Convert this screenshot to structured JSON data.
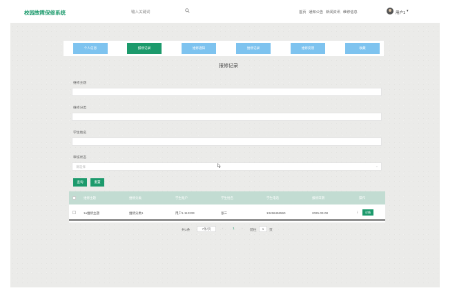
{
  "header": {
    "brand": "校园故障保修系统",
    "search_placeholder": "输入关键词",
    "nav": [
      "首页",
      "通知公告",
      "新闻资讯",
      "维修信息"
    ],
    "username": "用户1"
  },
  "tabs": [
    "个人信息",
    "报修记录",
    "维修通知",
    "维修记录",
    "维修反馈",
    "收藏"
  ],
  "active_tab_index": 1,
  "page_title": "报修记录",
  "filters": {
    "topic_label": "维修主题",
    "category_label": "维修分类",
    "student_label": "学生姓名",
    "status_label": "审核状态",
    "status_placeholder": "请选择"
  },
  "buttons": {
    "search": "查询",
    "reset": "重置"
  },
  "table": {
    "headers": [
      "维修主题",
      "维修分类",
      "学生账户",
      "学生姓名",
      "学生电话",
      "报修日期",
      "操作"
    ],
    "rows": [
      {
        "topic": "1a维修主题",
        "category": "维修分类1",
        "account": "用户1-112233",
        "name": "张三",
        "phone": "13456456560",
        "date": "2025-03-08",
        "action": "详情"
      }
    ]
  },
  "pagination": {
    "total": "共1条",
    "page_size": "7条/页",
    "current_page": "1",
    "goto_label": "前往",
    "goto_value": "1",
    "page_unit": "页"
  },
  "colors": {
    "accent": "#1c9a6c",
    "tab": "#7ec3ef",
    "table_header": "#c2dcd2"
  }
}
